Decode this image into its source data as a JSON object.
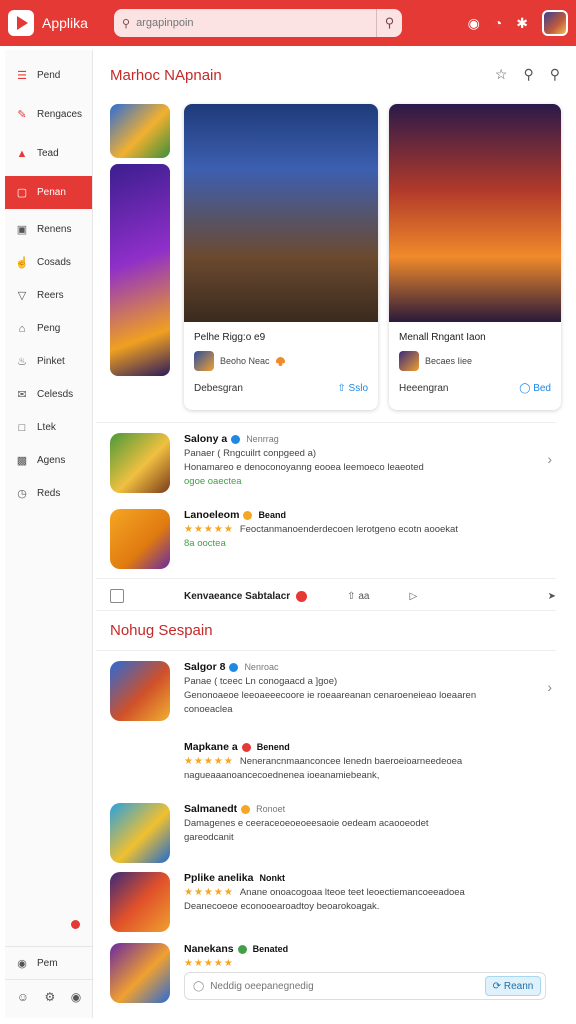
{
  "app": {
    "title": "Applika",
    "accent": "#e53935"
  },
  "search": {
    "placeholder": "argapinpoin"
  },
  "sidebar": {
    "items": [
      {
        "label": "Pend",
        "icon": "menu-icon"
      },
      {
        "label": "Rengaces",
        "icon": "pen-icon"
      },
      {
        "label": "Tead",
        "icon": "triangle-icon"
      },
      {
        "label": "Penan",
        "icon": "folder-icon",
        "active": true
      },
      {
        "label": "Renens",
        "icon": "image-icon"
      },
      {
        "label": "Cosads",
        "icon": "thumb-icon"
      },
      {
        "label": "Reers",
        "icon": "filter-icon"
      },
      {
        "label": "Peng",
        "icon": "home-icon"
      },
      {
        "label": "Pinket",
        "icon": "bell-icon"
      },
      {
        "label": "Celesds",
        "icon": "mail-icon"
      },
      {
        "label": "Ltek",
        "icon": "box-icon"
      },
      {
        "label": "Agens",
        "icon": "gift-icon"
      },
      {
        "label": "Reds",
        "icon": "clock-icon"
      }
    ],
    "bottom_item": {
      "label": "Pem",
      "icon": "info-icon"
    }
  },
  "section1": {
    "title": "Marhoc NApnain",
    "featured": [
      {
        "name": "Pelhe Rigg:o e9",
        "meta": "Beoho Neac",
        "left": "Debesgran",
        "action": "Sslo"
      },
      {
        "name": "Menall Rngant Iaon",
        "meta": "Becaes Iiee",
        "left": "Heeengran",
        "action": "Bed"
      }
    ],
    "apps": [
      {
        "name": "Salony a",
        "tag": "Nenrrag",
        "lines": [
          "Panaer ( Rngcuilrt conpgeed a)",
          "Honamareo e denoconoyanng eooea leemoeco leaeoted"
        ],
        "extra": "ogoe oaectea"
      },
      {
        "name": "Lanoeleom",
        "tag": "Beand",
        "lines": [
          "Feoctanmanoenderdecoen lerotgeno ecotn aooekat"
        ],
        "extra": "8a ooctea",
        "stars": "★★★★★"
      }
    ],
    "toolbar": {
      "label": "Kenvaeance Sabtalacr",
      "count": "aa"
    }
  },
  "section2": {
    "title": "Nohug Sespain",
    "apps": [
      {
        "name": "Salgor 8",
        "tag": "Nenroac",
        "lines": [
          "Panae ( tceec Ln conogaacd a ]goe)",
          "Genonoaeoe leeoaeeecoore ie roeaareanan cenaroeneieao loeaaren"
        ],
        "extra": "conoeaclea"
      },
      {
        "name": "Mapkane a",
        "tag": "Benend",
        "lines": [
          "Nenerancnmaanconcee lenedn baeroeioarneedeoea"
        ],
        "extra": "nagueaaanoancecoednenea ioeanamiebeank,",
        "stars": "★★★★★"
      },
      {
        "name": "Salmanedt",
        "tag": "Ronoet",
        "lines": [
          "Damagenes e ceeraceoeoeoeesaoie oedeam acaooeodet"
        ],
        "extra": "gareodcanit"
      },
      {
        "name": "Pplike anelika",
        "tag": "Nonkt",
        "lines": [
          "Anane onoacogoaa lteoe teet leoectiemancoeeadoea"
        ],
        "extra": "Deanecoeoe econooearoadtoy beoarokoagak.",
        "stars": "★★★★★"
      },
      {
        "name": "Nanekans",
        "tag": "Benated",
        "lines": [],
        "extra": "",
        "stars": "★★★★★"
      }
    ]
  },
  "composer": {
    "placeholder": "Neddig oeepanegnedig",
    "button": "Reann"
  }
}
